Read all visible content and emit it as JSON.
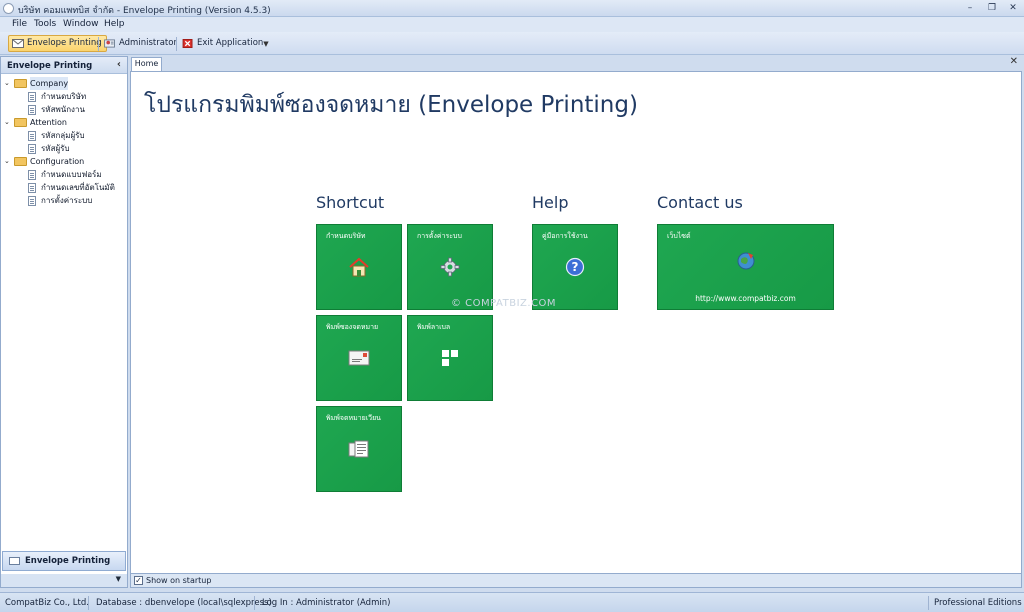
{
  "window": {
    "title": "บริษัท คอมแพทบิส จำกัด - Envelope Printing (Version 4.5.3)",
    "controls": {
      "minimize": "–",
      "restore": "❐",
      "close": "✕"
    }
  },
  "menu": [
    "File",
    "Tools",
    "Window",
    "Help"
  ],
  "toolbar": {
    "envelope_printing": "Envelope Printing",
    "administrator": "Administrator",
    "exit_application": "Exit Application"
  },
  "nav": {
    "header": "Envelope Printing",
    "tree": [
      {
        "label": "Company",
        "children": [
          "กำหนดบริษัท",
          "รหัสพนักงาน"
        ]
      },
      {
        "label": "Attention",
        "children": [
          "รหัสกลุ่มผู้รับ",
          "รหัสผู้รับ"
        ]
      },
      {
        "label": "Configuration",
        "children": [
          "กำหนดแบบฟอร์ม",
          "กำหนดเลขที่อัตโนมัติ",
          "การตั้งค่าระบบ"
        ]
      }
    ],
    "group_button": "Envelope Printing"
  },
  "tabs": {
    "home": "Home"
  },
  "home": {
    "title": "โปรแกรมพิมพ์ซองจดหมาย (Envelope Printing)",
    "watermark": "© COMPATBIZ.COM",
    "sections": {
      "shortcut": "Shortcut",
      "help": "Help",
      "contact": "Contact us"
    },
    "tiles": {
      "company": "กำหนดบริษัท",
      "settings": "การตั้งค่าระบบ",
      "print_envelope": "พิมพ์ซองจดหมาย",
      "print_label": "พิมพ์ลาเบล",
      "print_letter": "พิมพ์จดหมายเวียน",
      "manual": "คู่มือการใช้งาน",
      "website": "เว็บไซต์",
      "website_url": "http://www.compatbiz.com"
    },
    "show_on_startup": "Show on startup"
  },
  "status": {
    "company": "CompatBiz Co., Ltd.",
    "database": "Database : dbenvelope (local\\sqlexpress)",
    "login": "Log In : Administrator (Admin)",
    "edition": "Professional Editions"
  },
  "colors": {
    "tile": "#1fa751",
    "accent": "#fbd46e",
    "title_text": "#203a63"
  }
}
